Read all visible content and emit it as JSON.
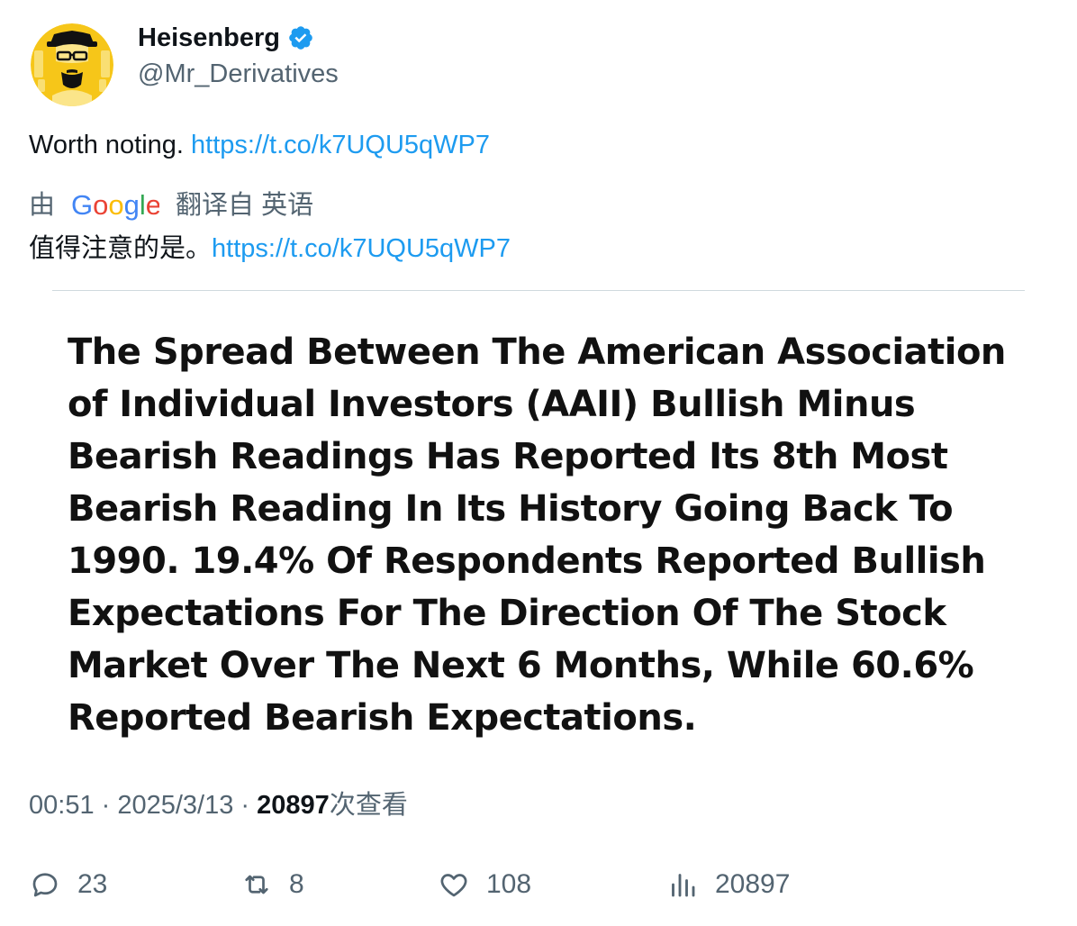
{
  "author": {
    "display_name": "Heisenberg",
    "handle": "@Mr_Derivatives",
    "verified_color": "#1d9bf0",
    "avatar_bg": "#f6c619"
  },
  "tweet": {
    "text": "Worth noting. ",
    "link": "https://t.co/k7UQU5qWP7"
  },
  "translation": {
    "prefix": "由",
    "provider": "Google",
    "suffix": "翻译自 英语",
    "text": "值得注意的是。",
    "link": "https://t.co/k7UQU5qWP7"
  },
  "quote_image": {
    "text": "The Spread Between The American Association of Individual Investors (AAII) Bullish Minus Bearish Readings Has Reported Its 8th Most Bearish Reading In Its History Going Back To 1990. 19.4% Of Respondents Reported Bullish Expectations For The Direction Of The Stock Market Over The Next 6 Months, While 60.6% Reported Bearish Expectations."
  },
  "meta": {
    "time": "00:51",
    "separator": " · ",
    "date": "2025/3/13",
    "views_count": "20897",
    "views_label": "次查看"
  },
  "actions": {
    "replies": "23",
    "retweets": "8",
    "likes": "108",
    "views": "20897"
  },
  "colors": {
    "link": "#1d9bf0",
    "secondary": "#536471",
    "primary": "#0f1419"
  }
}
